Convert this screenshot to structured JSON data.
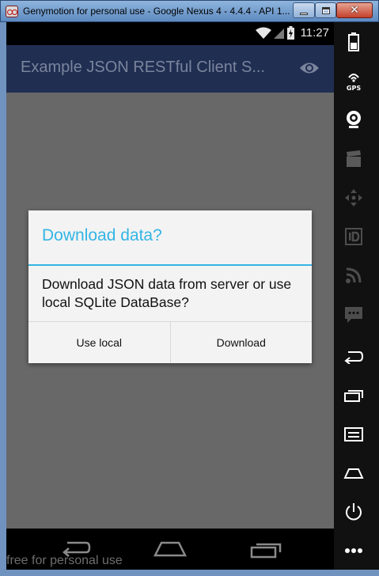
{
  "window": {
    "title": "Genymotion for personal use - Google Nexus 4 - 4.4.4 - API 1..."
  },
  "status_bar": {
    "time": "11:27"
  },
  "action_bar": {
    "title": "Example JSON RESTful Client S..."
  },
  "dialog": {
    "title": "Download data?",
    "message": "Download JSON data from server or use local SQLite DataBase?",
    "buttons": {
      "use_local": "Use local",
      "download": "Download"
    }
  },
  "watermark": "free for personal use",
  "sidebar": {
    "gps_label": "GPS",
    "icons": [
      "battery-icon",
      "gps-icon",
      "camera-icon",
      "media-icon",
      "dpad-icon",
      "id-icon",
      "rss-icon",
      "sms-icon",
      "back-icon",
      "recent-apps-icon",
      "menu-icon",
      "home-icon",
      "power-icon",
      "more-icon"
    ]
  },
  "colors": {
    "accent": "#33b5e5",
    "action_bar": "#202e52",
    "screen_dim": "#686868"
  }
}
